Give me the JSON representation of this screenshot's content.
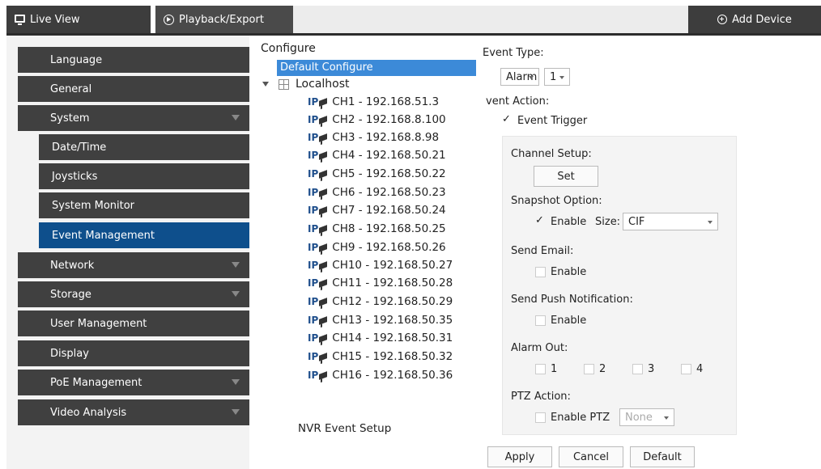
{
  "tabs": {
    "live_view": "Live View",
    "playback": "Playback/Export",
    "add_device": "Add Device"
  },
  "sidebar": {
    "items": [
      {
        "label": "Language",
        "expandable": false
      },
      {
        "label": "General",
        "expandable": false
      },
      {
        "label": "System",
        "expandable": true
      },
      {
        "label": "Date/Time",
        "sub": true
      },
      {
        "label": "Joysticks",
        "sub": true
      },
      {
        "label": "System Monitor",
        "sub": true
      },
      {
        "label": "Event Management",
        "sub": true,
        "active": true
      },
      {
        "label": "Network",
        "expandable": true
      },
      {
        "label": "Storage",
        "expandable": true
      },
      {
        "label": "User Management",
        "expandable": false
      },
      {
        "label": "Display",
        "expandable": false
      },
      {
        "label": "PoE Management",
        "expandable": true
      },
      {
        "label": "Video Analysis",
        "expandable": true
      }
    ]
  },
  "tree": {
    "header": "Configure",
    "default_configure": "Default Configure",
    "localhost": "Localhost",
    "ip_label": "IP",
    "channels": [
      "CH1 - 192.168.51.3",
      "CH2 - 192.168.8.100",
      "CH3 - 192.168.8.98",
      "CH4 - 192.168.50.21",
      "CH5 - 192.168.50.22",
      "CH6 - 192.168.50.23",
      "CH7 - 192.168.50.24",
      "CH8 - 192.168.50.25",
      "CH9 - 192.168.50.26",
      "CH10 - 192.168.50.27",
      "CH11 - 192.168.50.28",
      "CH12 - 192.168.50.29",
      "CH13 - 192.168.50.35",
      "CH14 - 192.168.50.31",
      "CH15 - 192.168.50.32",
      "CH16 - 192.168.50.36"
    ],
    "nvr_event_setup": "NVR Event Setup"
  },
  "event": {
    "type_label": "Event Type:",
    "type_value": "Alarm",
    "type_index": "1",
    "action_label": "vent Action:",
    "trigger_label": "Event Trigger",
    "channel_setup_label": "Channel Setup:",
    "set_button": "Set",
    "snapshot_label": "Snapshot Option:",
    "snapshot_enable": "Enable",
    "size_label": "Size:",
    "size_value": "CIF",
    "email_label": "Send Email:",
    "email_enable": "Enable",
    "push_label": "Send Push Notification:",
    "push_enable": "Enable",
    "alarm_out_label": "Alarm Out:",
    "alarm_outs": [
      "1",
      "2",
      "3",
      "4"
    ],
    "ptz_label": "PTZ Action:",
    "ptz_enable": "Enable PTZ",
    "ptz_value": "None"
  },
  "buttons": {
    "apply": "Apply",
    "cancel": "Cancel",
    "default": "Default"
  }
}
